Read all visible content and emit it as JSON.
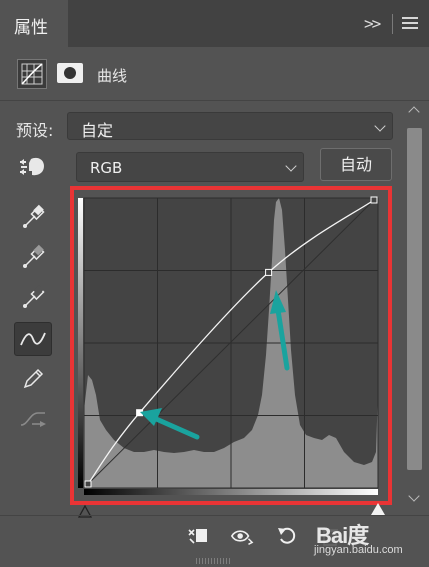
{
  "tab": {
    "title": "属性",
    "collapse_glyph": ">>"
  },
  "adjustment": {
    "title": "曲线"
  },
  "preset": {
    "label": "预设:",
    "value": "自定"
  },
  "channel": {
    "value": "RGB",
    "auto_label": "自动"
  },
  "tools": [
    {
      "name": "on-image-adjust-icon"
    },
    {
      "name": "black-point-eyedropper-icon"
    },
    {
      "name": "gray-point-eyedropper-icon"
    },
    {
      "name": "white-point-eyedropper-icon"
    },
    {
      "name": "edit-points-curve-icon",
      "active": true
    },
    {
      "name": "pencil-draw-icon"
    },
    {
      "name": "smooth-curve-icon",
      "disabled": true
    }
  ],
  "curve": {
    "input_range": [
      0,
      255
    ],
    "output_range": [
      0,
      255
    ],
    "points": [
      [
        0,
        0
      ],
      [
        46,
        64
      ],
      [
        161,
        190
      ],
      [
        255,
        255
      ]
    ],
    "grid_divisions": 4
  },
  "bottom_bar": {
    "icons": [
      "clip-to-layer-icon",
      "visibility-eye-icon",
      "reset-icon",
      "delete-icon"
    ]
  },
  "watermark": {
    "logo": "Bai度",
    "url": "jingyan.baidu.com"
  },
  "colors": {
    "highlight_border": "#e93435",
    "arrow": "#1aa39e",
    "panel": "#535353"
  }
}
